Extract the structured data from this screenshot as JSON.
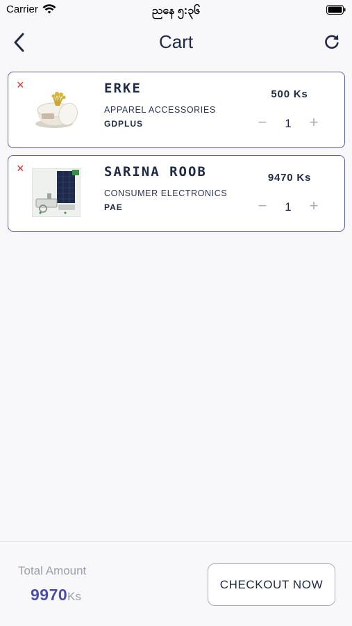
{
  "status_bar": {
    "carrier": "Carrier",
    "time": "ညနေ ၅:၃၆",
    "icons": [
      "wifi-icon",
      "battery-icon"
    ]
  },
  "nav": {
    "title": "Cart",
    "back_icon": "chevron-left-icon",
    "refresh_icon": "refresh-icon"
  },
  "cart": {
    "items": [
      {
        "name": "ERKE",
        "category": "APPAREL ACCESSORIES",
        "brand": "GDPLUS",
        "price": "500 Ks",
        "quantity": "1",
        "remove_icon": "close-icon",
        "image": "product-photo"
      },
      {
        "name": "SARINA ROOB",
        "category": "CONSUMER ELECTRONICS",
        "brand": "PAE",
        "price": "9470 Ks",
        "quantity": "1",
        "remove_icon": "close-icon",
        "image": "product-photo"
      }
    ],
    "qty_minus_symbol": "−",
    "qty_plus_symbol": "+",
    "remove_symbol": "×"
  },
  "footer": {
    "total_label": "Total Amount",
    "total_value": "9970",
    "total_currency": "Ks",
    "checkout_label": "CHECKOUT NOW"
  },
  "colors": {
    "accent": "#4d4fa0",
    "card_border": "#5b5fa8",
    "remove": "#d02a2a",
    "text": "#1f2a44",
    "muted": "#9aa0ad"
  }
}
